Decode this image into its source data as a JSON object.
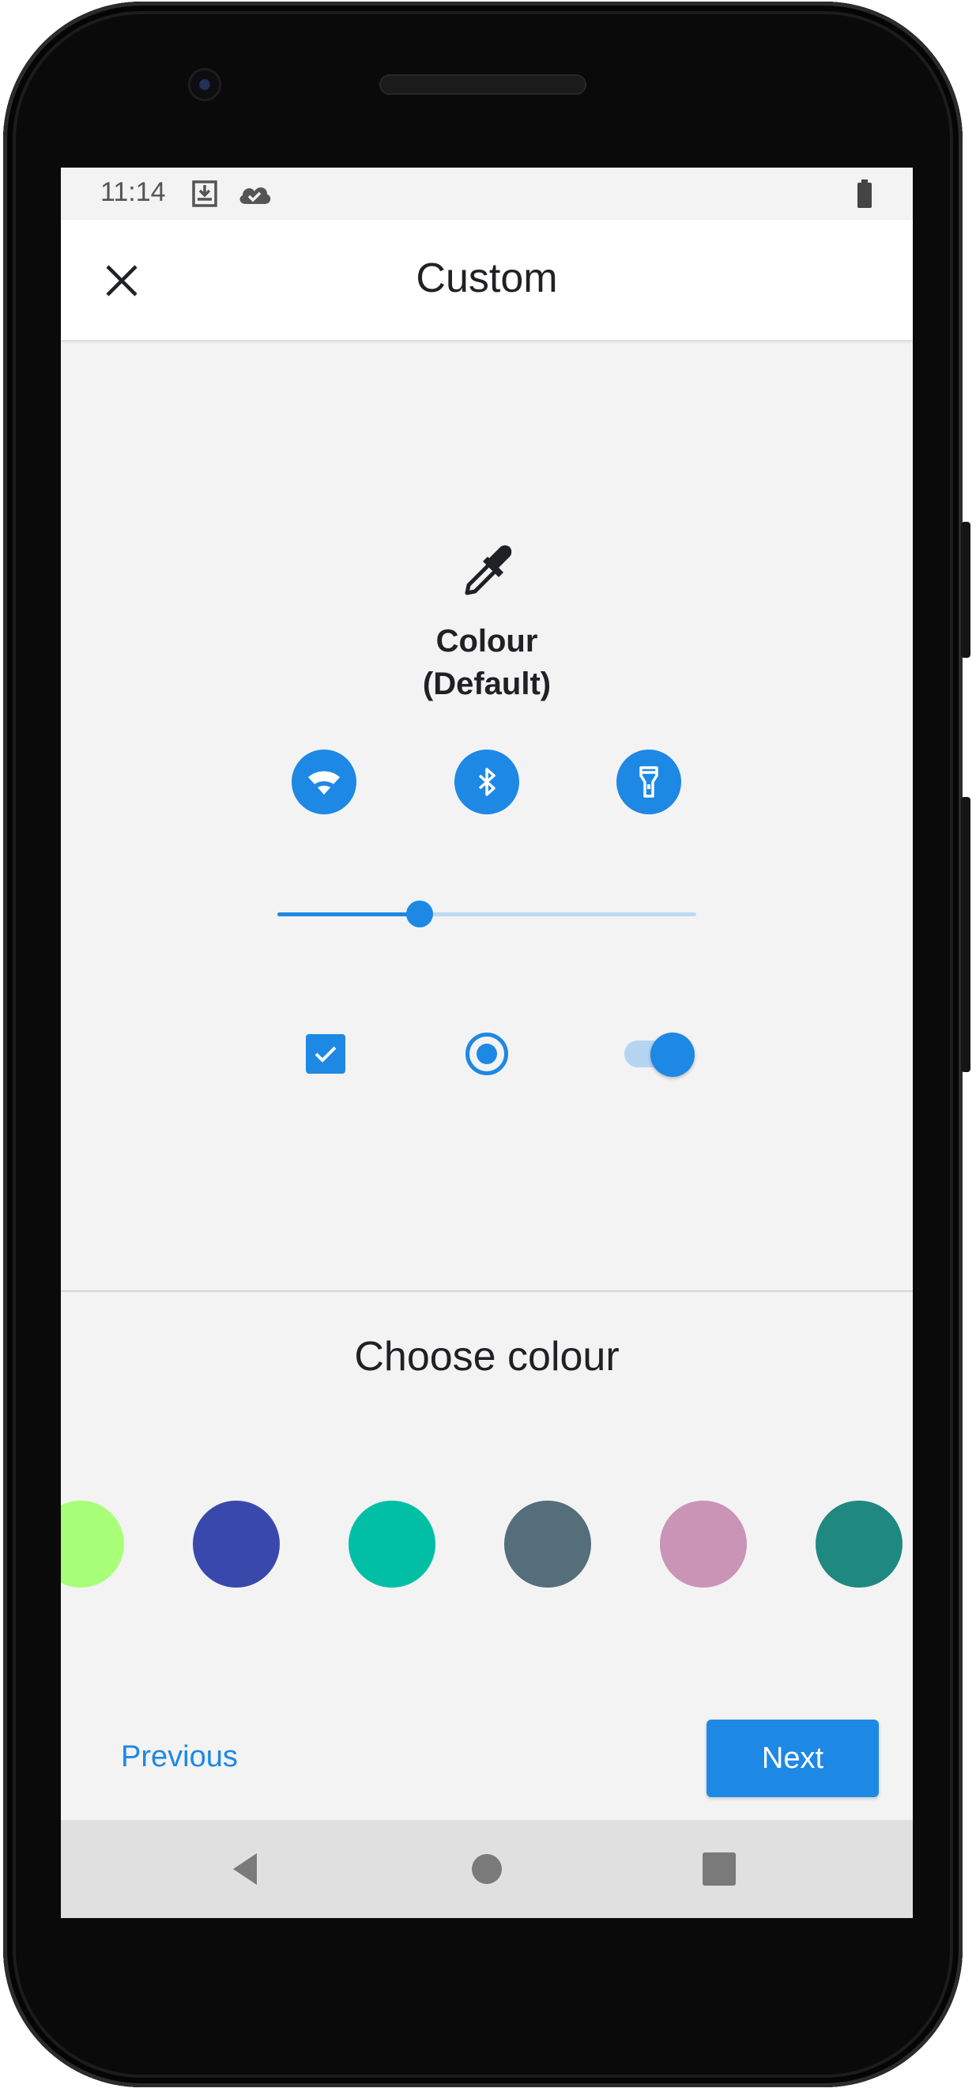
{
  "status_bar": {
    "time": "11:14",
    "icons": [
      "download-done-icon",
      "cloud-done-icon",
      "battery-icon"
    ]
  },
  "app_bar": {
    "title": "Custom",
    "close_icon": "close-icon"
  },
  "preview": {
    "icon": "eyedropper-icon",
    "style_label": "Colour\n(Default)",
    "quick_buttons": [
      "wifi-icon",
      "bluetooth-icon",
      "flashlight-icon"
    ],
    "slider_value_percent": 34,
    "checkbox_checked": true,
    "radio_selected": true,
    "switch_on": true
  },
  "palette": {
    "title": "Choose colour",
    "swatches": [
      "#a8ff78",
      "#3949ab",
      "#00bfa5",
      "#546e7a",
      "#c994b6",
      "#20897f"
    ]
  },
  "footer": {
    "previous_label": "Previous",
    "next_label": "Next"
  },
  "nav_bar": {
    "icons": [
      "back-icon",
      "home-icon",
      "recents-icon"
    ]
  },
  "colors": {
    "accent": "#1e88e5",
    "screen_background": "#f3f3f3",
    "nav_background": "#e0e0e0"
  }
}
